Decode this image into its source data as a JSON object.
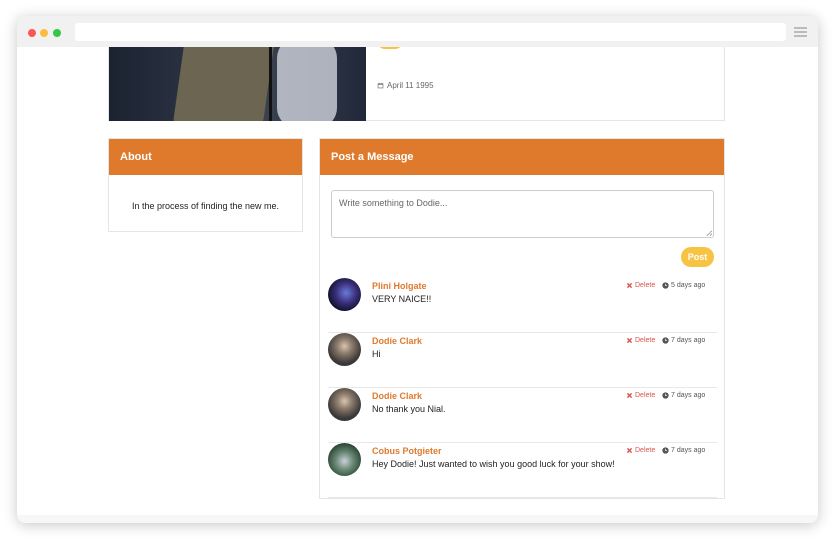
{
  "profile": {
    "birthday": "April 11 1995"
  },
  "about": {
    "title": "About",
    "text": "In the process of finding the new me."
  },
  "post_panel": {
    "title": "Post a Message",
    "placeholder": "Write something to Dodie...",
    "post_label": "Post"
  },
  "messages": [
    {
      "author": "Plini Holgate",
      "text": "VERY NAICE!!",
      "delete_label": "Delete",
      "time": "5 days ago"
    },
    {
      "author": "Dodie Clark",
      "text": "Hi",
      "delete_label": "Delete",
      "time": "7 days ago"
    },
    {
      "author": "Dodie Clark",
      "text": "No thank you Nial.",
      "delete_label": "Delete",
      "time": "7 days ago"
    },
    {
      "author": "Cobus Potgieter",
      "text": "Hey Dodie! Just wanted to wish you good luck for your show!",
      "delete_label": "Delete",
      "time": "7 days ago"
    }
  ],
  "colors": {
    "accent": "#df7a2d",
    "button": "#f6c343",
    "delete": "#d9534f"
  },
  "icons": {
    "birthday": "calendar-icon",
    "delete": "x-icon",
    "time": "clock-icon",
    "menu": "hamburger-icon"
  }
}
